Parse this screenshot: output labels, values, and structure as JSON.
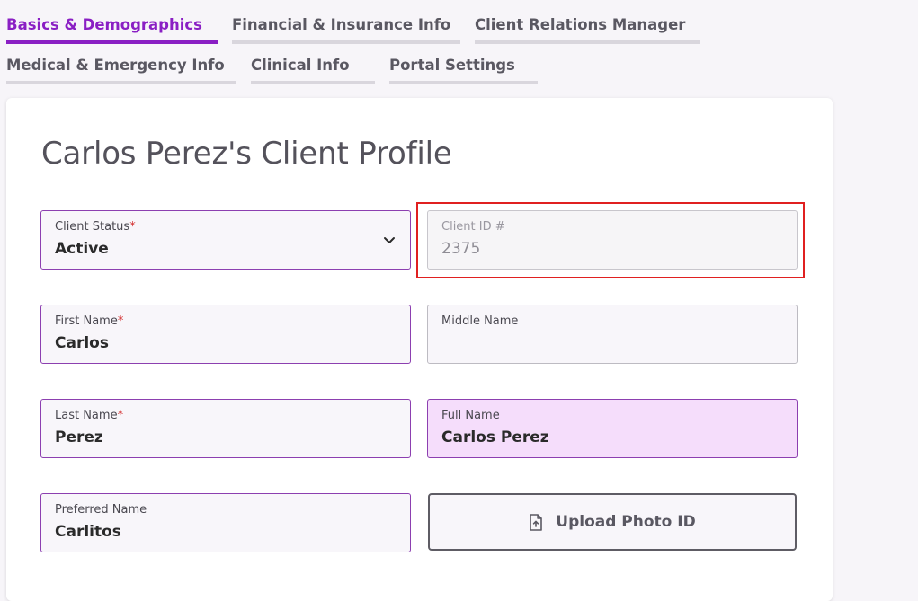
{
  "tabs": [
    {
      "label": "Basics & Demographics",
      "active": true
    },
    {
      "label": "Financial & Insurance Info",
      "active": false
    },
    {
      "label": "Client Relations Manager",
      "active": false
    },
    {
      "label": "Medical & Emergency Info",
      "active": false
    },
    {
      "label": "Clinical Info",
      "active": false
    },
    {
      "label": "Portal Settings",
      "active": false
    }
  ],
  "profile": {
    "title": "Carlos Perez's Client Profile",
    "required_marker": "*",
    "client_status": {
      "label": "Client Status",
      "value": "Active"
    },
    "client_id": {
      "label": "Client ID #",
      "value": "2375"
    },
    "first_name": {
      "label": "First Name",
      "value": "Carlos"
    },
    "middle_name": {
      "label": "Middle Name",
      "value": ""
    },
    "last_name": {
      "label": "Last Name",
      "value": "Perez"
    },
    "full_name": {
      "label": "Full Name",
      "value": "Carlos Perez"
    },
    "preferred_name": {
      "label": "Preferred Name",
      "value": "Carlitos"
    },
    "upload_photo_label": "Upload Photo ID"
  },
  "colors": {
    "accent": "#8a1fc4",
    "field_border": "#8c3fb0",
    "full_name_fill": "#f5ddfb",
    "required": "#d32f2f",
    "highlight": "#e02020"
  },
  "icons": {
    "status_dropdown": "chevron-down-icon",
    "upload": "file-upload-icon"
  }
}
